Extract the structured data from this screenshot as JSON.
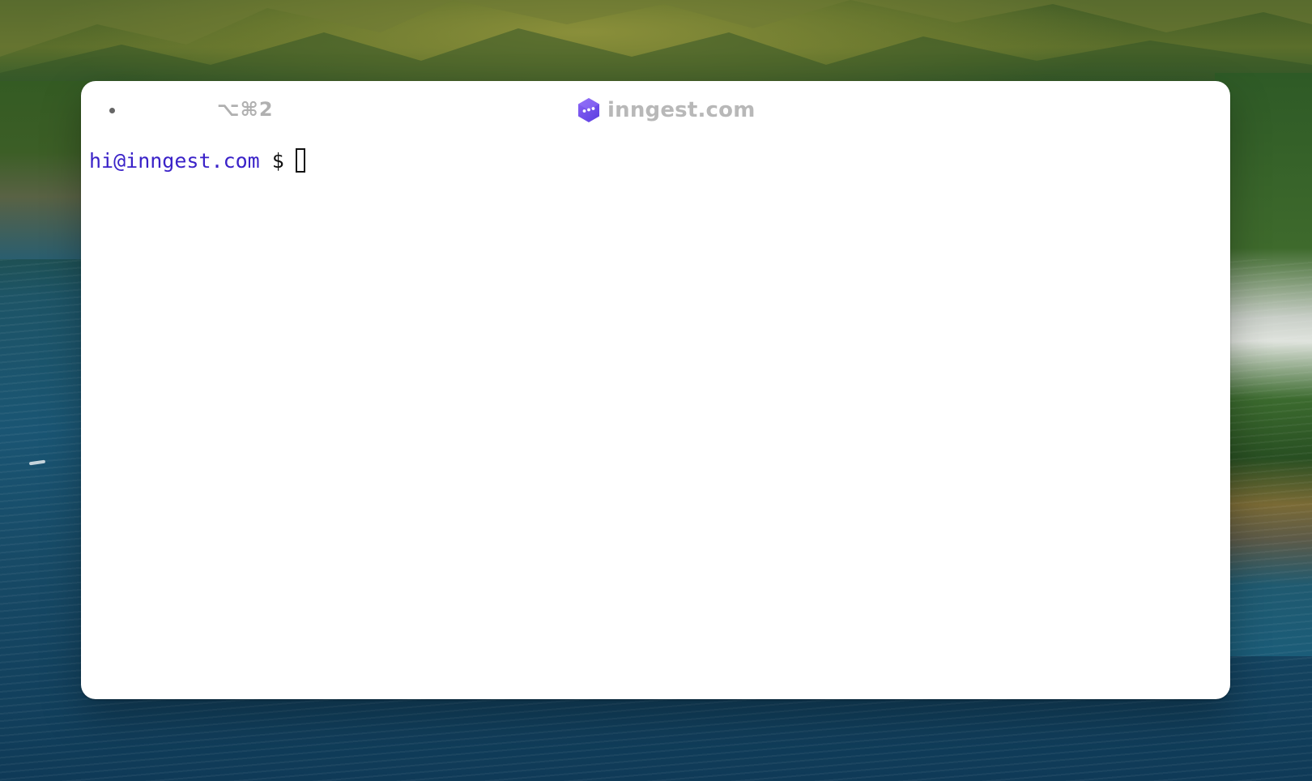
{
  "window": {
    "tab_indicator": "•",
    "tab_shortcut": "⌥⌘2",
    "title": "inngest.com",
    "logo_icon": "inngest-logo-icon"
  },
  "terminal": {
    "prompt_user": "hi@inngest.com",
    "prompt_symbol": "$",
    "input_value": ""
  },
  "colors": {
    "prompt_user": "#3a22c8",
    "logo": "#6f4ef2",
    "title_text": "#b8b8b8"
  }
}
